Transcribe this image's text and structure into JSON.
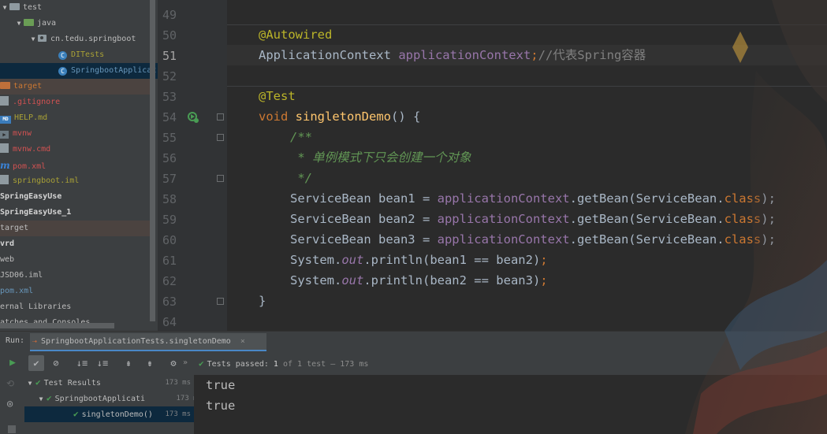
{
  "project_tree": {
    "items": [
      {
        "label": "test"
      },
      {
        "label": "java"
      },
      {
        "label": "cn.tedu.springboot"
      },
      {
        "label": "DITests"
      },
      {
        "label": "SpringbootApplicat"
      },
      {
        "label": "target"
      },
      {
        "label": ".gitignore"
      },
      {
        "label": "HELP.md"
      },
      {
        "label": "mvnw"
      },
      {
        "label": "mvnw.cmd"
      },
      {
        "label": "pom.xml"
      },
      {
        "label": "springboot.iml"
      },
      {
        "label": "SpringEasyUse"
      },
      {
        "label": "SpringEasyUse_1"
      },
      {
        "label": "target"
      },
      {
        "label": "vrd"
      },
      {
        "label": "web"
      },
      {
        "label": "JSD06.iml"
      },
      {
        "label": "pom.xml"
      },
      {
        "label": "ernal Libraries"
      },
      {
        "label": "atches and Consoles"
      }
    ]
  },
  "editor": {
    "line_numbers": [
      "49",
      "50",
      "51",
      "52",
      "53",
      "54",
      "55",
      "56",
      "57",
      "58",
      "59",
      "60",
      "61",
      "62",
      "63",
      "64"
    ],
    "code": {
      "l50": "@Autowired",
      "l51_type": "ApplicationContext ",
      "l51_field": "applicationContext",
      "l51_semi": ";",
      "l51_comment": "//代表Spring容器",
      "l53": "@Test",
      "l54_kw": "void ",
      "l54_name": "singletonDemo",
      "l54_rest": "() {",
      "l55": "/**",
      "l56": " * 单例模式下只会创建一个对象",
      "l57": " */",
      "l58_a": "ServiceBean bean1 = ",
      "l59_a": "ServiceBean bean2 = ",
      "l60_a": "ServiceBean bean3 = ",
      "ctx": "applicationContext",
      "getbean": ".getBean(ServiceBean.",
      "cls_kw": "class",
      "close_semi": ");",
      "sys": "System.",
      "out": "out",
      "println1": ".println(bean1 == bean2)",
      "println2": ".println(bean2 == bean3)",
      "semi": ";",
      "close_brace": "}"
    }
  },
  "run_panel": {
    "run_label": "Run:",
    "tab_label": "SpringbootApplicationTests.singletonDemo",
    "tab_close": "×",
    "status_prefix": "Tests passed: ",
    "status_count": "1",
    "status_of": " of 1 test",
    "status_time": " – 173 ms",
    "results": [
      {
        "label": "Test Results",
        "time": "173 ms"
      },
      {
        "label": "SpringbootApplicati",
        "time": "173 ms"
      },
      {
        "label": "singletonDemo()",
        "time": "173 ms"
      }
    ],
    "console_lines": [
      "true",
      "true"
    ]
  },
  "colors": {
    "background": "#2b2b2b",
    "panel": "#3c3f41",
    "keyword": "#cc7832",
    "annotation": "#bbb529",
    "field": "#9876aa",
    "method": "#ffc66d",
    "comment": "#629755",
    "pass_green": "#499c54"
  }
}
